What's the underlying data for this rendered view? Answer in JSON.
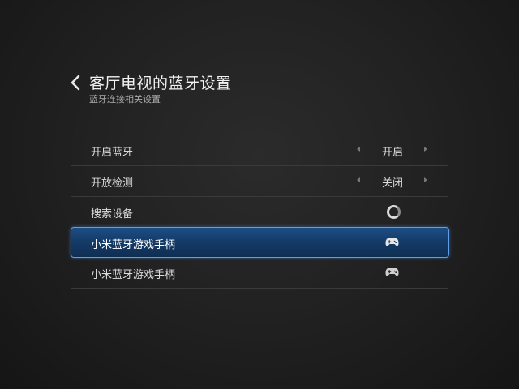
{
  "header": {
    "title": "客厅电视的蓝牙设置",
    "subtitle": "蓝牙连接相关设置",
    "back_icon": "chevron-left-icon"
  },
  "settings": [
    {
      "label": "开启蓝牙",
      "value": "开启",
      "control": "toggle-arrows"
    },
    {
      "label": "开放检测",
      "value": "关闭",
      "control": "toggle-arrows"
    },
    {
      "label": "搜索设备",
      "control": "spinner-icon"
    },
    {
      "label": "小米蓝牙游戏手柄",
      "control": "gamepad-icon",
      "selected": true
    },
    {
      "label": "小米蓝牙游戏手柄",
      "control": "gamepad-icon"
    }
  ],
  "colors": {
    "background": "#202020",
    "selection_fill": "#174473",
    "selection_border": "#5e9ee6",
    "text": "#dcdcdc"
  }
}
